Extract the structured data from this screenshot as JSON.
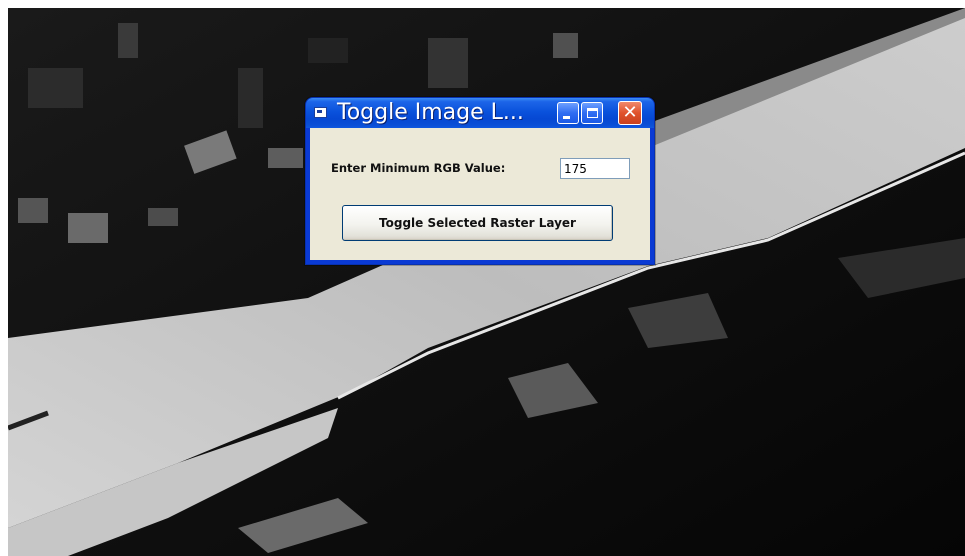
{
  "dialog": {
    "title": "Toggle Image L...",
    "min_rgb_label": "Enter Minimum RGB Value:",
    "min_rgb_value": "175",
    "toggle_button_label": "Toggle Selected Raster Layer",
    "minimize_icon": "minimize-icon",
    "maximize_icon": "maximize-icon",
    "close_icon": "close-icon",
    "close_glyph": "✕",
    "title_icon": "window-app-icon"
  },
  "colors": {
    "titlebar_blue": "#0a52dc",
    "client_bg": "#ece9d8",
    "close_red": "#e0532c",
    "raster_dark": "#0d0d0d",
    "raster_light": "#cfcfcf"
  }
}
